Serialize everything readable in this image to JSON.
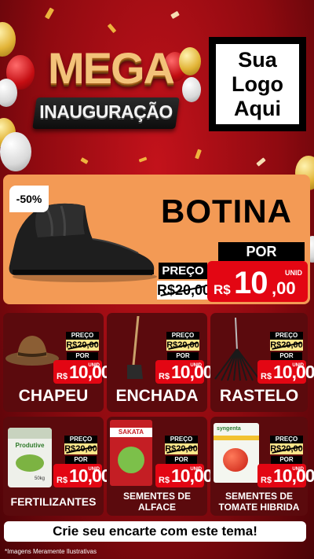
{
  "banner": {
    "title_main": "MEGA",
    "title_sub": "INAUGURAÇÃO",
    "logo_text": "Sua Logo Aqui"
  },
  "hero": {
    "discount_badge": "-50%",
    "product_name": "BOTINA",
    "preco_label": "PREÇO",
    "old_price": "R$20,00",
    "por_label": "POR",
    "currency": "R$",
    "new_price_int": "10",
    "new_price_dec": ",00",
    "unit_label": "UNID"
  },
  "products": [
    {
      "name": "CHAPEU",
      "preco_label": "PREÇO",
      "old_price": "R$20,00",
      "por_label": "POR",
      "currency": "R$",
      "new_price": "10,00",
      "unit_label": "UNID"
    },
    {
      "name": "ENCHADA",
      "preco_label": "PREÇO",
      "old_price": "R$20,00",
      "por_label": "POR",
      "currency": "R$",
      "new_price": "10,00",
      "unit_label": "UNID"
    },
    {
      "name": "RASTELO",
      "preco_label": "PREÇO",
      "old_price": "R$20,00",
      "por_label": "POR",
      "currency": "R$",
      "new_price": "10,00",
      "unit_label": "UNID"
    },
    {
      "name": "FERTILIZANTES",
      "preco_label": "PREÇO",
      "old_price": "R$20,00",
      "por_label": "POR",
      "currency": "R$",
      "new_price": "10,00",
      "unit_label": "UNID",
      "package_brand": "Produtive",
      "package_weight": "50kg"
    },
    {
      "name": "SEMENTES DE ALFACE",
      "preco_label": "PREÇO",
      "old_price": "R$20,00",
      "por_label": "POR",
      "currency": "R$",
      "new_price": "10,00",
      "unit_label": "UNID",
      "package_brand": "SAKATA"
    },
    {
      "name": "SEMENTES DE TOMATE HIBRIDA",
      "preco_label": "PREÇO",
      "old_price": "R$20,00",
      "por_label": "POR",
      "currency": "R$",
      "new_price": "10,00",
      "unit_label": "UNID",
      "package_brand": "syngenta"
    }
  ],
  "cta": "Crie seu encarte com este tema!",
  "disclaimer": "*Imagens Meramente Ilustrativas",
  "colors": {
    "background": "#a30d14",
    "hero": "#f39a55",
    "card": "#5b0a0d",
    "price_red": "#e30613",
    "old_price_bg": "#fde68a"
  }
}
